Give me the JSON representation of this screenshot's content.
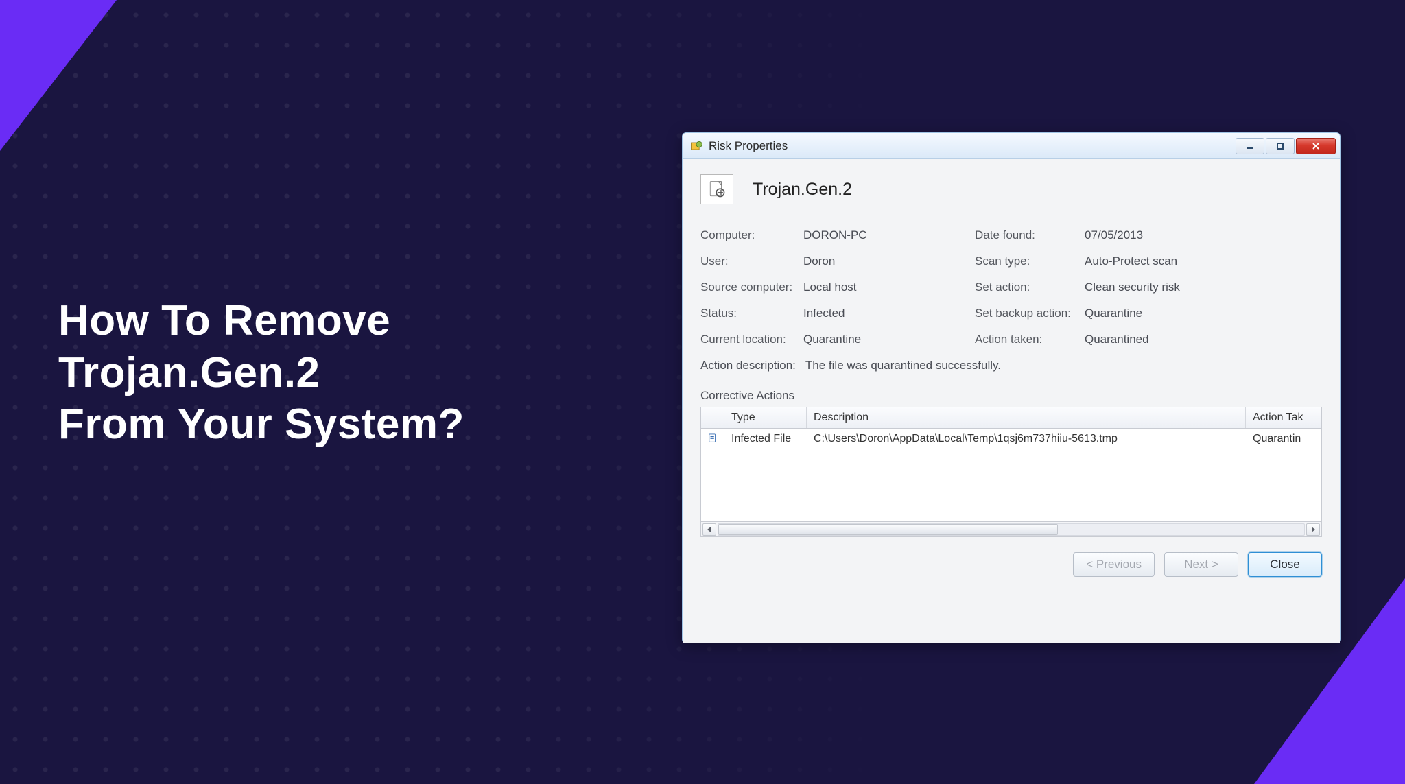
{
  "headline": {
    "line1": "How To Remove",
    "line2": "Trojan.Gen.2",
    "line3": "From Your System?"
  },
  "window": {
    "title": "Risk Properties",
    "threat_name": "Trojan.Gen.2",
    "properties": {
      "computer_label": "Computer:",
      "computer_value": "DORON-PC",
      "user_label": "User:",
      "user_value": "Doron",
      "source_label": "Source computer:",
      "source_value": "Local host",
      "status_label": "Status:",
      "status_value": "Infected",
      "location_label": "Current location:",
      "location_value": "Quarantine",
      "date_label": "Date found:",
      "date_value": "07/05/2013",
      "scantype_label": "Scan type:",
      "scantype_value": "Auto-Protect scan",
      "setaction_label": "Set action:",
      "setaction_value": "Clean security risk",
      "setbackup_label": "Set backup action:",
      "setbackup_value": "Quarantine",
      "taken_label": "Action taken:",
      "taken_value": "Quarantined"
    },
    "action_desc_label": "Action description:",
    "action_desc_value": "The file was quarantined successfully.",
    "corrective_title": "Corrective Actions",
    "table": {
      "headers": {
        "type": "Type",
        "description": "Description",
        "action": "Action Tak"
      },
      "row": {
        "type": "Infected File",
        "description": "C:\\Users\\Doron\\AppData\\Local\\Temp\\1qsj6m737hiiu-5613.tmp",
        "action": "Quarantin"
      }
    },
    "buttons": {
      "prev": "< Previous",
      "next": "Next >",
      "close": "Close"
    }
  }
}
